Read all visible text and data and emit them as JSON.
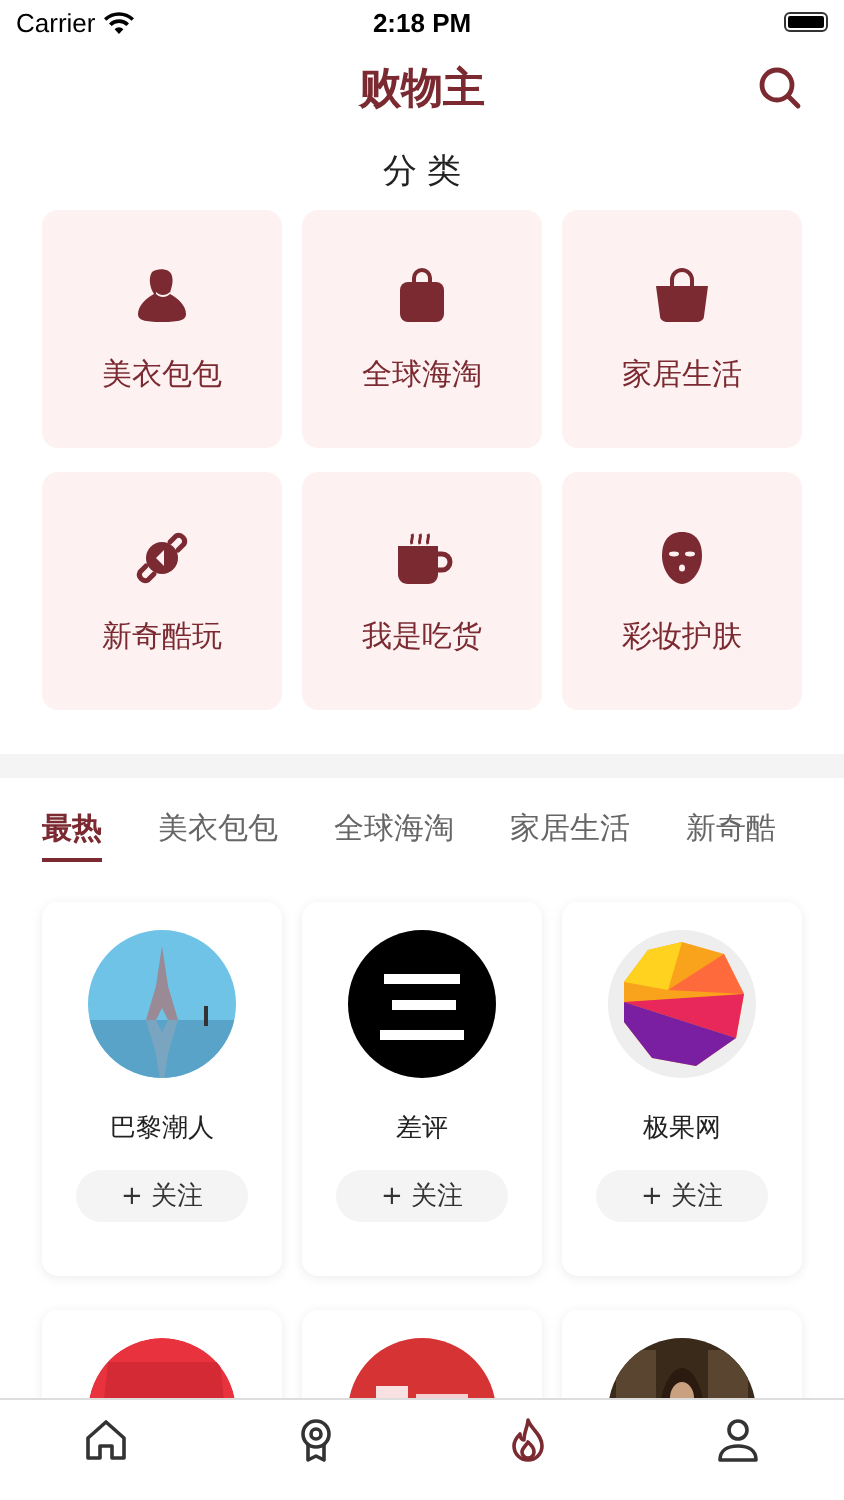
{
  "status_bar": {
    "carrier": "Carrier",
    "time": "2:18 PM"
  },
  "header": {
    "title": "败物主"
  },
  "categories_section": {
    "title": "分 类",
    "items": [
      {
        "label": "美衣包包",
        "kind": "dress"
      },
      {
        "label": "全球海淘",
        "kind": "bag"
      },
      {
        "label": "家居生活",
        "kind": "basket"
      },
      {
        "label": "新奇酷玩",
        "kind": "gadget"
      },
      {
        "label": "我是吃货",
        "kind": "mug"
      },
      {
        "label": "彩妆护肤",
        "kind": "mask"
      }
    ]
  },
  "tabs": [
    {
      "label": "最热",
      "selected": true
    },
    {
      "label": "美衣包包",
      "selected": false
    },
    {
      "label": "全球海淘",
      "selected": false
    },
    {
      "label": "家居生活",
      "selected": false
    },
    {
      "label": "新奇酷",
      "selected": false
    }
  ],
  "accounts": [
    {
      "kind": "picture",
      "name": "巴黎潮人",
      "follow": "+ 关注"
    },
    {
      "kind": "picture",
      "name": "差评",
      "follow": "+ 关注"
    },
    {
      "kind": "picture",
      "name": "极果网",
      "follow": "+ 关注"
    },
    {
      "kind": "picture"
    },
    {
      "kind": "picture"
    },
    {
      "kind": "picture"
    }
  ],
  "tab_bar": [
    {
      "kind": "home",
      "selected": false
    },
    {
      "kind": "award",
      "selected": false
    },
    {
      "kind": "flame",
      "selected": true
    },
    {
      "kind": "person",
      "selected": false
    }
  ]
}
